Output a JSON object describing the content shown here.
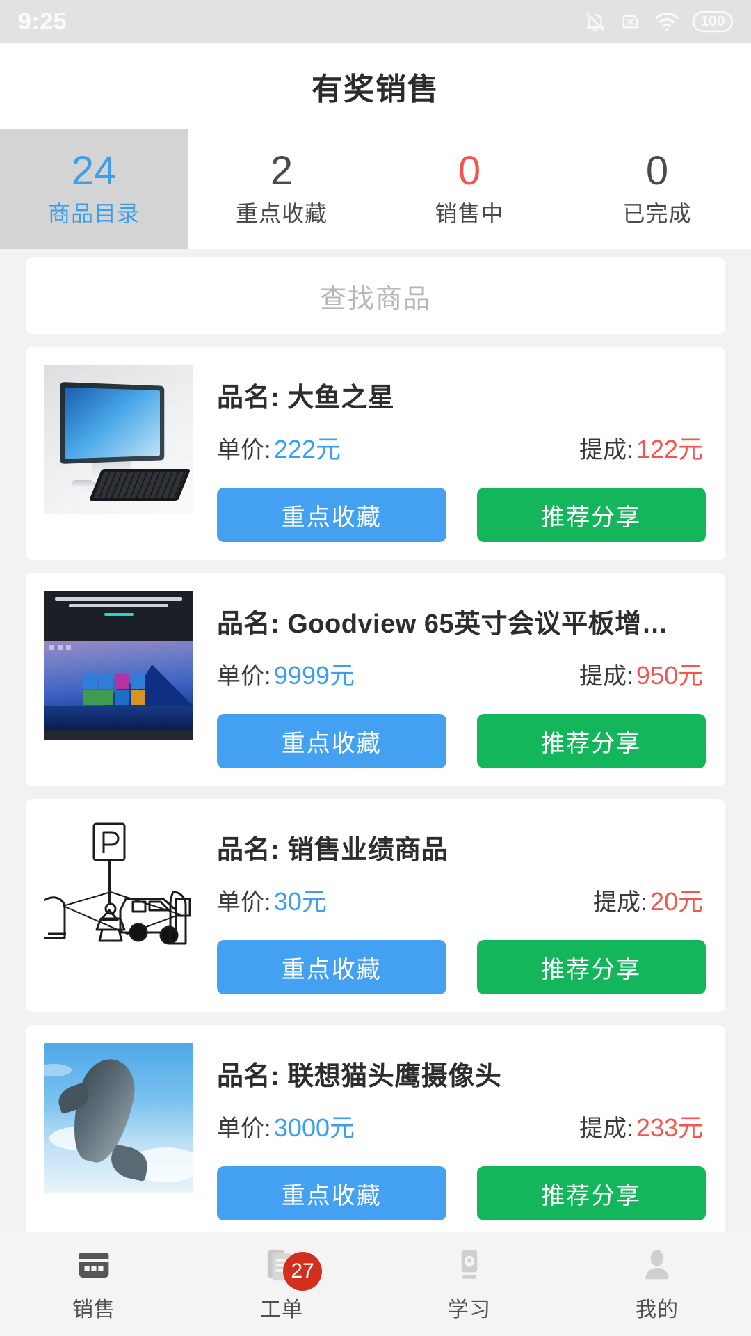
{
  "status_bar": {
    "time": "9:25",
    "icons": [
      "bell-mute-icon",
      "sim-x-icon",
      "wifi-icon",
      "battery-icon"
    ],
    "battery_level": "100"
  },
  "header": {
    "title": "有奖销售"
  },
  "tabs": [
    {
      "count": "24",
      "label": "商品目录",
      "active": true,
      "color": "#3c9ef0"
    },
    {
      "count": "2",
      "label": "重点收藏",
      "active": false,
      "color": "#4a4a4a"
    },
    {
      "count": "0",
      "label": "销售中",
      "active": false,
      "color": "#f4554e"
    },
    {
      "count": "0",
      "label": "已完成",
      "active": false,
      "color": "#4a4a4a"
    }
  ],
  "search": {
    "placeholder": "查找商品"
  },
  "labels": {
    "name_prefix": "品名:",
    "price_prefix": "单价:",
    "commission_prefix": "提成:",
    "favorite_button": "重点收藏",
    "share_button": "推荐分享"
  },
  "products": [
    {
      "name": "品名: 大鱼之星",
      "price": "222元",
      "commission": "122元",
      "thumb": "all-in-one-computer-photo"
    },
    {
      "name": "品名: Goodview 65英寸会议平板增…",
      "price": "9999元",
      "commission": "950元",
      "thumb": "conference-tablet-photo"
    },
    {
      "name": "品名: 销售业绩商品",
      "price": "30元",
      "commission": "20元",
      "thumb": "parking-line-art"
    },
    {
      "name": "品名: 联想猫头鹰摄像头",
      "price": "3000元",
      "commission": "233元",
      "thumb": "dolphin-photo"
    }
  ],
  "bottom_nav": [
    {
      "label": "销售",
      "icon": "sales-card-icon",
      "active": true,
      "badge": ""
    },
    {
      "label": "工单",
      "icon": "work-order-icon",
      "active": false,
      "badge": "27"
    },
    {
      "label": "学习",
      "icon": "study-icon",
      "active": false,
      "badge": ""
    },
    {
      "label": "我的",
      "icon": "profile-icon",
      "active": false,
      "badge": ""
    }
  ],
  "colors": {
    "accent_blue": "#3c9ef0",
    "button_blue": "#44a0f0",
    "button_green": "#13b65a",
    "commission_red": "#f4554e",
    "badge_red": "#d32f1f",
    "page_bg": "#f2f2f2"
  }
}
